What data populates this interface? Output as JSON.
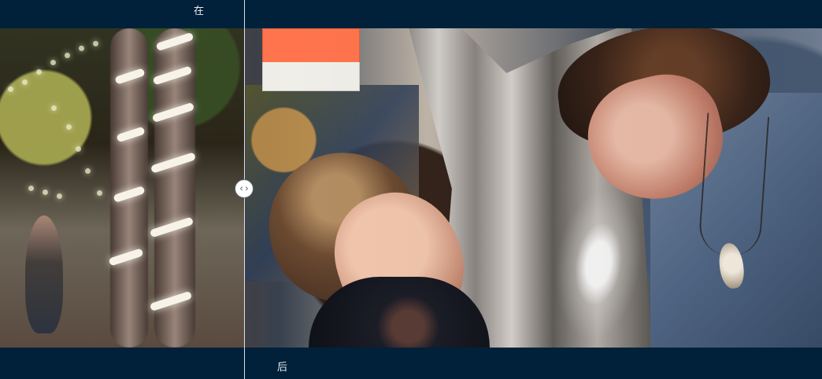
{
  "labels": {
    "before": "在",
    "after": "后"
  },
  "compare": {
    "handle_icon": "horizontal-resize-icon",
    "handle_glyph": "‹ ›"
  },
  "colors": {
    "background": "#002139",
    "divider": "#d8e0e8",
    "handle": "#ffffff",
    "text": "#e8eef5"
  }
}
